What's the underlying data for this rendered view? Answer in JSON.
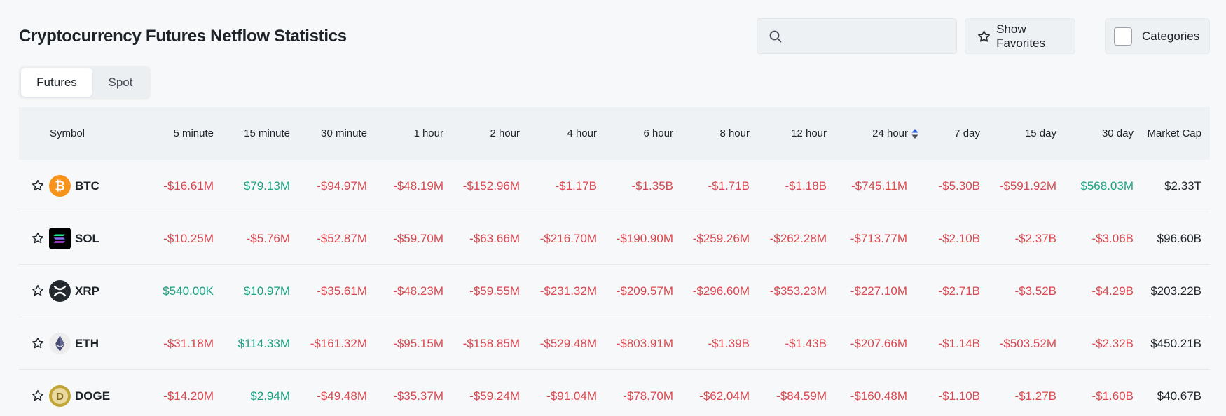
{
  "title": "Cryptocurrency Futures Netflow Statistics",
  "search": {
    "placeholder": "",
    "value": ""
  },
  "buttons": {
    "favorites": "Show Favorites",
    "categories": "Categories"
  },
  "tabs": [
    "Futures",
    "Spot"
  ],
  "active_tab": "Futures",
  "colors": {
    "negative": "#d9484f",
    "positive": "#1aa283",
    "sort_active": "#2a5bd7"
  },
  "table": {
    "headers": {
      "symbol": "Symbol",
      "m5": "5 minute",
      "m15": "15 minute",
      "m30": "30 minute",
      "h1": "1 hour",
      "h2": "2 hour",
      "h4": "4 hour",
      "h6": "6 hour",
      "h8": "8 hour",
      "h12": "12 hour",
      "h24": "24 hour",
      "d7": "7 day",
      "d15": "15 day",
      "d30": "30 day",
      "mcap": "Market Cap"
    },
    "sorted_by": "24 hour",
    "rows": [
      {
        "symbol": "BTC",
        "icon": "bitcoin-icon",
        "m5": "-$16.61M",
        "m15": "$79.13M",
        "m30": "-$94.97M",
        "h1": "-$48.19M",
        "h2": "-$152.96M",
        "h4": "-$1.17B",
        "h6": "-$1.35B",
        "h8": "-$1.71B",
        "h12": "-$1.18B",
        "h24": "-$745.11M",
        "d7": "-$5.30B",
        "d15": "-$591.92M",
        "d30": "$568.03M",
        "mcap": "$2.33T"
      },
      {
        "symbol": "SOL",
        "icon": "solana-icon",
        "m5": "-$10.25M",
        "m15": "-$5.76M",
        "m30": "-$52.87M",
        "h1": "-$59.70M",
        "h2": "-$63.66M",
        "h4": "-$216.70M",
        "h6": "-$190.90M",
        "h8": "-$259.26M",
        "h12": "-$262.28M",
        "h24": "-$713.77M",
        "d7": "-$2.10B",
        "d15": "-$2.37B",
        "d30": "-$3.06B",
        "mcap": "$96.60B"
      },
      {
        "symbol": "XRP",
        "icon": "xrp-icon",
        "m5": "$540.00K",
        "m15": "$10.97M",
        "m30": "-$35.61M",
        "h1": "-$48.23M",
        "h2": "-$59.55M",
        "h4": "-$231.32M",
        "h6": "-$209.57M",
        "h8": "-$296.60M",
        "h12": "-$353.23M",
        "h24": "-$227.10M",
        "d7": "-$2.71B",
        "d15": "-$3.52B",
        "d30": "-$4.29B",
        "mcap": "$203.22B"
      },
      {
        "symbol": "ETH",
        "icon": "ethereum-icon",
        "m5": "-$31.18M",
        "m15": "$114.33M",
        "m30": "-$161.32M",
        "h1": "-$95.15M",
        "h2": "-$158.85M",
        "h4": "-$529.48M",
        "h6": "-$803.91M",
        "h8": "-$1.39B",
        "h12": "-$1.43B",
        "h24": "-$207.66M",
        "d7": "-$1.14B",
        "d15": "-$503.52M",
        "d30": "-$2.32B",
        "mcap": "$450.21B"
      },
      {
        "symbol": "DOGE",
        "icon": "dogecoin-icon",
        "m5": "-$14.20M",
        "m15": "$2.94M",
        "m30": "-$49.48M",
        "h1": "-$35.37M",
        "h2": "-$59.24M",
        "h4": "-$91.04M",
        "h6": "-$78.70M",
        "h8": "-$62.04M",
        "h12": "-$84.59M",
        "h24": "-$160.48M",
        "d7": "-$1.10B",
        "d15": "-$1.27B",
        "d30": "-$1.60B",
        "mcap": "$40.67B"
      }
    ]
  }
}
